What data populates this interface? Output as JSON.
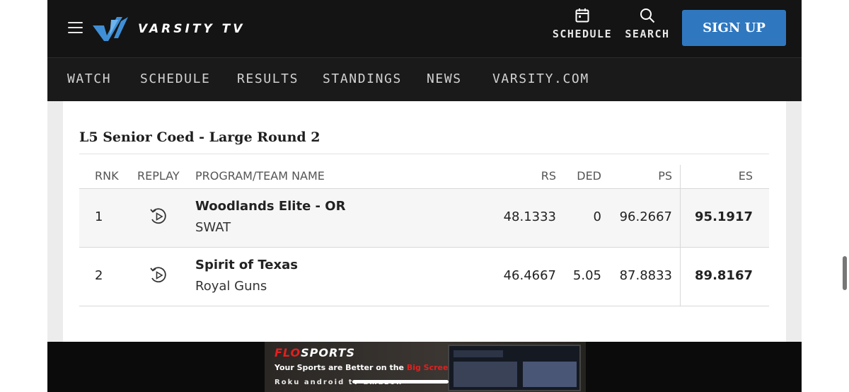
{
  "header": {
    "brand": "VARSITY TV",
    "schedule_label": "SCHEDULE",
    "search_label": "SEARCH",
    "signup_label": "SIGN UP"
  },
  "nav": {
    "items": [
      {
        "label": "WATCH"
      },
      {
        "label": "SCHEDULE"
      },
      {
        "label": "RESULTS"
      },
      {
        "label": "STANDINGS"
      },
      {
        "label": "NEWS"
      },
      {
        "label": "VARSITY.COM"
      }
    ]
  },
  "results": {
    "title": "L5 Senior Coed - Large Round 2",
    "columns": {
      "rank": "RNK",
      "replay": "REPLAY",
      "team": "PROGRAM/TEAM NAME",
      "rs": "RS",
      "ded": "DED",
      "ps": "PS",
      "es": "ES"
    },
    "rows": [
      {
        "rank": "1",
        "program": "Woodlands Elite - OR",
        "team": "SWAT",
        "rs": "48.1333",
        "ded": "0",
        "ps": "96.2667",
        "es": "95.1917"
      },
      {
        "rank": "2",
        "program": "Spirit of Texas",
        "team": "Royal Guns",
        "rs": "46.4667",
        "ded": "5.05",
        "ps": "87.8833",
        "es": "89.8167"
      }
    ]
  },
  "ad": {
    "logo_prefix": "FLO",
    "logo_suffix": "SPORTS",
    "tagline_start": "Your Sports are Better on the ",
    "tagline_highlight": "Big Screen",
    "brands": "Roku  android  tv  amazon"
  },
  "colors": {
    "accent": "#2f78c0",
    "header_bg": "#141414",
    "flo_red": "#e2201f"
  }
}
